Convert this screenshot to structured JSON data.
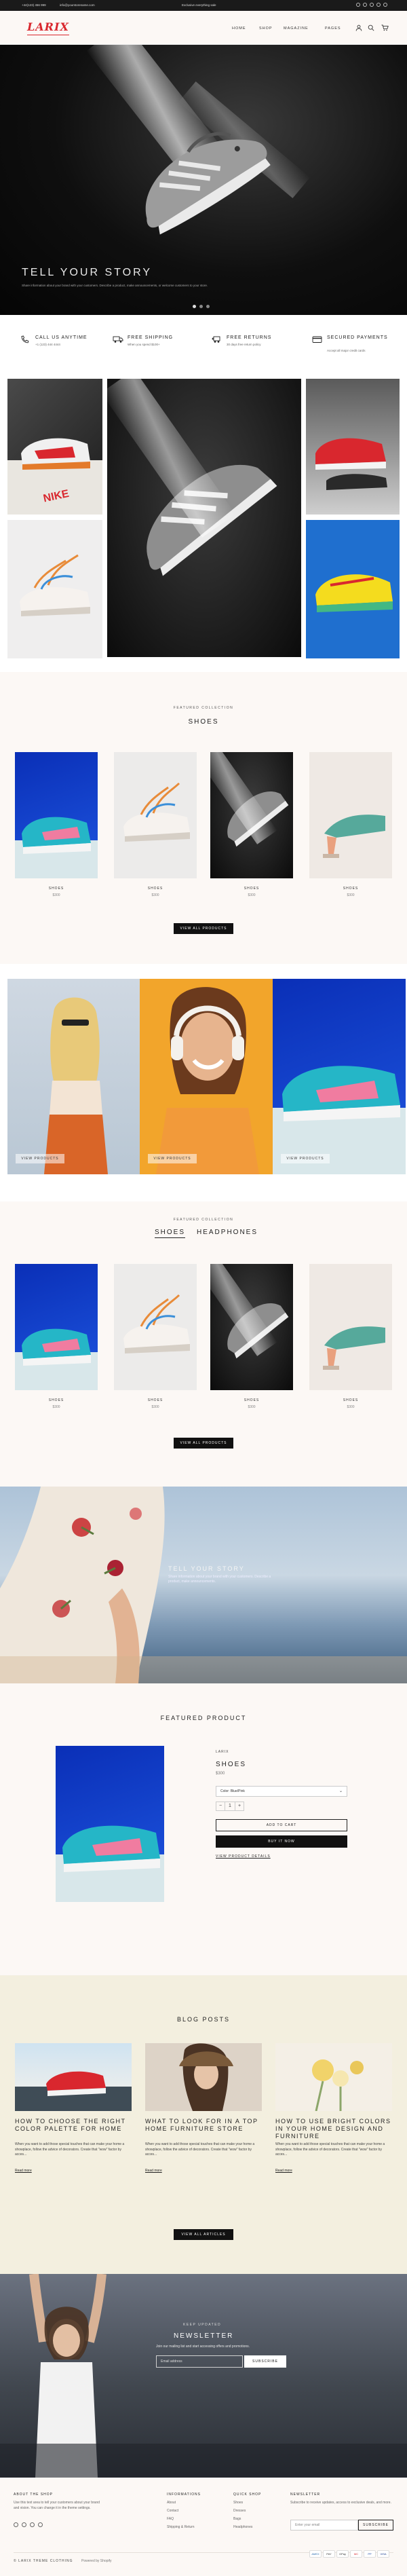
{
  "topbar": {
    "phone": "+44(123) 456 999",
    "email": "info@yourstorename.com",
    "promo": "Exclusive everything sale"
  },
  "header": {
    "logo": "LARIX",
    "nav": [
      "HOME",
      "SHOP",
      "MAGAZINE",
      "PAGES"
    ],
    "icons": [
      "user-icon",
      "search-icon",
      "cart-icon"
    ]
  },
  "hero": {
    "title": "TELL YOUR STORY",
    "subtitle": "Share information about your brand with your customers. Describe a product, make announcements, or welcome customers to your store."
  },
  "features": [
    {
      "icon": "phone-icon",
      "title": "CALL US ANYTIME",
      "subtitle": "+1 (123) 444 4444"
    },
    {
      "icon": "truck-icon",
      "title": "FREE SHIPPING",
      "subtitle": "When you spend $100+"
    },
    {
      "icon": "return-icon",
      "title": "FREE RETURNS",
      "subtitle": "30 days free return policy"
    },
    {
      "icon": "card-icon",
      "title": "SECURED PAYMENTS",
      "subtitle": "Accept all major credit cards"
    }
  ],
  "featured_collection": {
    "label": "FEATURED COLLECTION",
    "title": "SHOES",
    "products": [
      {
        "name": "SHOES",
        "price": "$300"
      },
      {
        "name": "SHOES",
        "price": "$300"
      },
      {
        "name": "SHOES",
        "price": "$300"
      },
      {
        "name": "SHOES",
        "price": "$300"
      }
    ],
    "button": "VIEW ALL PRODUCTS"
  },
  "banners": [
    {
      "button": "VIEW PRODUCTS"
    },
    {
      "button": "VIEW PRODUCTS"
    },
    {
      "button": "VIEW PRODUCTS"
    }
  ],
  "tabbed_collection": {
    "label": "FEATURED COLLECTION",
    "tabs": [
      "SHOES",
      "HEADPHONES"
    ],
    "products": [
      {
        "name": "SHOES",
        "price": "$300"
      },
      {
        "name": "SHOES",
        "price": "$300"
      },
      {
        "name": "SHOES",
        "price": "$300"
      },
      {
        "name": "SHOES",
        "price": "$300"
      }
    ],
    "button": "VIEW ALL PRODUCTS"
  },
  "story": {
    "title": "TELL YOUR STORY",
    "text": "Share information about your brand with your customers. Describe a product, make announcements."
  },
  "featured_product": {
    "heading": "FEATURED PRODUCT",
    "vendor": "LARIX",
    "name": "SHOES",
    "price": "$300",
    "color_label": "Color",
    "color_value": "Color: Blue/Pink",
    "quantity": "1",
    "add_to_cart": "ADD TO CART",
    "buy_now": "BUY IT NOW",
    "details_link": "VIEW PRODUCT DETAILS"
  },
  "blog": {
    "heading": "BLOG POSTS",
    "posts": [
      {
        "title": "HOW TO CHOOSE THE RIGHT COLOR PALETTE FOR HOME",
        "excerpt": "When you want to add those special touches that can make your home a showplace, follow the advice of decorators. Create that \"wow\" factor by acces...",
        "more": "Read more"
      },
      {
        "title": "WHAT TO LOOK FOR IN A TOP HOME FURNITURE STORE",
        "excerpt": "When you want to add those special touches that can make your home a showplace, follow the advice of decorators. Create that \"wow\" factor by acces...",
        "more": "Read more"
      },
      {
        "title": "HOW TO USE BRIGHT COLORS IN YOUR HOME DESIGN AND FURNITURE",
        "excerpt": "When you want to add those special touches that can make your home a showplace, follow the advice of decorators. Create that \"wow\" factor by acces...",
        "more": "Read more"
      }
    ],
    "button": "VIEW ALL ARTICLES"
  },
  "newsletter": {
    "label": "KEEP UPDATED",
    "title": "NEWSLETTER",
    "text": "Join our mailing list and start accessing offers and promotions.",
    "placeholder": "Email address",
    "button": "SUBSCRIBE"
  },
  "footer": {
    "about_heading": "ABOUT THE SHOP",
    "about_text": "Use this text area to tell your customers about your brand and vision. You can change it in the theme settings.",
    "info_heading": "INFORMATIONS",
    "info_links": [
      "About",
      "Contact",
      "FAQ",
      "Shipping & Return"
    ],
    "quick_heading": "QUICK SHOP",
    "quick_links": [
      "Shoes",
      "Dresses",
      "Bags",
      "Headphones"
    ],
    "newsletter_heading": "NEWSLETTER",
    "newsletter_text": "Subscribe to receive updates, access to exclusive deals, and more.",
    "newsletter_placeholder": "Enter your email",
    "newsletter_button": "SUBSCRIBE",
    "copyright": "© LARIX THEME CLOTHING",
    "powered": "Powered by Shopify",
    "payments": [
      "AMEX",
      "PAY",
      "GPay",
      "MC",
      "PP",
      "VISA"
    ]
  },
  "colors": {
    "accent": "#d9272e",
    "dark": "#111111",
    "header_bg": "#fcf8f5",
    "blog_bg": "#f3efdf"
  }
}
